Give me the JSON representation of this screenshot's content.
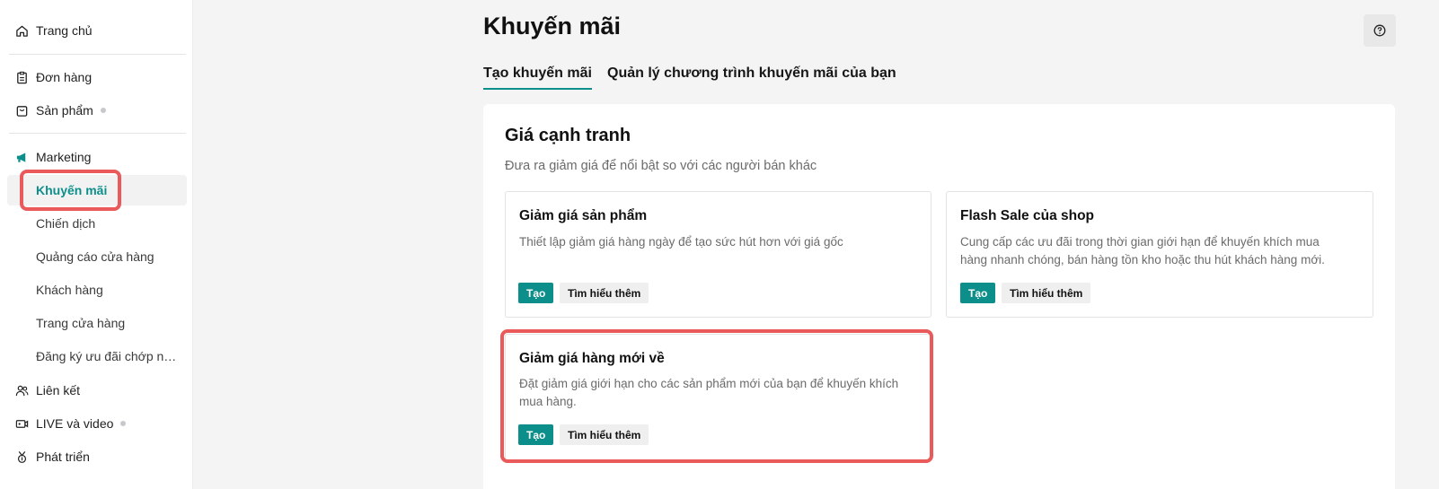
{
  "sidebar": {
    "items": [
      {
        "label": "Trang chủ",
        "icon": "home-icon"
      },
      {
        "label": "Đơn hàng",
        "icon": "clipboard-icon"
      },
      {
        "label": "Sản phẩm",
        "icon": "bag-icon"
      },
      {
        "label": "Marketing",
        "icon": "megaphone-icon"
      }
    ],
    "marketing_sub": [
      {
        "label": "Khuyến mãi"
      },
      {
        "label": "Chiến dịch"
      },
      {
        "label": "Quảng cáo cửa hàng"
      },
      {
        "label": "Khách hàng"
      },
      {
        "label": "Trang cửa hàng"
      },
      {
        "label": "Đăng ký ưu đãi chớp nhoáng"
      }
    ],
    "bottom_items": [
      {
        "label": "Liên kết",
        "icon": "users-icon"
      },
      {
        "label": "LIVE và video",
        "icon": "video-icon"
      },
      {
        "label": "Phát triển",
        "icon": "medal-icon"
      }
    ]
  },
  "header": {
    "title": "Khuyến mãi",
    "help_icon": "question-icon"
  },
  "tabs": [
    {
      "label": "Tạo khuyến mãi",
      "active": true
    },
    {
      "label": "Quản lý chương trình khuyến mãi của bạn",
      "active": false
    }
  ],
  "section": {
    "title": "Giá cạnh tranh",
    "subtitle": "Đưa ra giảm giá để nổi bật so với các người bán khác"
  },
  "cards": [
    {
      "title": "Giảm giá sản phẩm",
      "desc_lines": [
        "Thiết lập giảm giá hàng ngày để tạo sức hút hơn với giá gốc"
      ],
      "create_label": "Tạo",
      "learn_label": "Tìm hiểu thêm"
    },
    {
      "title": "Flash Sale của shop",
      "desc_lines": [
        "Cung cấp các ưu đãi trong thời gian giới hạn để khuyến khích mua",
        "hàng nhanh chóng, bán hàng tồn kho hoặc thu hút khách hàng mới."
      ],
      "create_label": "Tạo",
      "learn_label": "Tìm hiểu thêm"
    },
    {
      "title": "Giảm giá hàng mới về",
      "desc_lines": [
        "Đặt giảm giá giới hạn cho các sản phẩm mới của bạn để khuyến khích",
        "mua hàng."
      ],
      "create_label": "Tạo",
      "learn_label": "Tìm hiểu thêm"
    }
  ],
  "colors": {
    "accent": "#0c8f8a",
    "highlight": "#ea5a5a",
    "background": "#f4f4f4"
  }
}
